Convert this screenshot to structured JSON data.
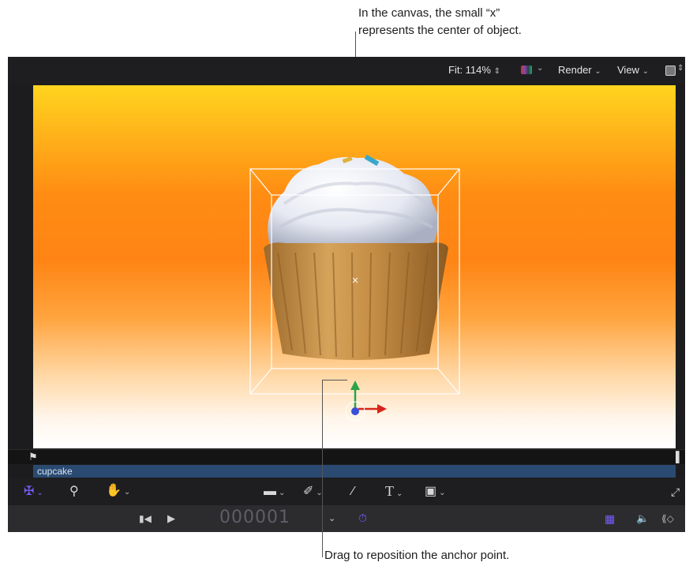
{
  "callouts": {
    "top_line1": "In the canvas, the small “x”",
    "top_line2": "represents the center of object.",
    "bottom": "Drag to reposition the anchor point."
  },
  "topbar": {
    "fit_label": "Fit: 114%",
    "render_label": "Render",
    "view_label": "View"
  },
  "timeline": {
    "clip_name": "cupcake"
  },
  "transport": {
    "timecode": "000001"
  },
  "colors": {
    "accent": "#7a5cff",
    "selection": "#2a4a72",
    "x_axis": "#d9221a",
    "y_axis": "#2aa44a",
    "anchor": "#3a4fd8"
  }
}
